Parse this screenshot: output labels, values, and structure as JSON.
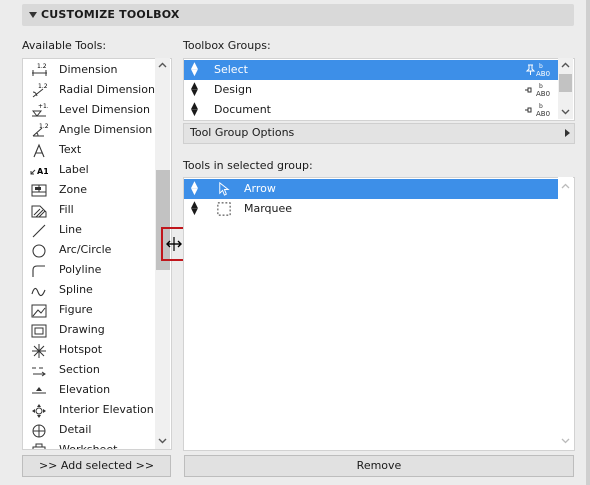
{
  "panel": {
    "title": "CUSTOMIZE TOOLBOX"
  },
  "available": {
    "label": "Available Tools:",
    "items": [
      {
        "label": "Dimension",
        "icon": "dimension-icon"
      },
      {
        "label": "Radial Dimension",
        "icon": "radial-dimension-icon"
      },
      {
        "label": "Level Dimension",
        "icon": "level-dimension-icon"
      },
      {
        "label": "Angle Dimension",
        "icon": "angle-dimension-icon"
      },
      {
        "label": "Text",
        "icon": "text-icon"
      },
      {
        "label": "Label",
        "icon": "label-icon"
      },
      {
        "label": "Zone",
        "icon": "zone-icon"
      },
      {
        "label": "Fill",
        "icon": "fill-icon"
      },
      {
        "label": "Line",
        "icon": "line-icon"
      },
      {
        "label": "Arc/Circle",
        "icon": "arc-circle-icon"
      },
      {
        "label": "Polyline",
        "icon": "polyline-icon"
      },
      {
        "label": "Spline",
        "icon": "spline-icon"
      },
      {
        "label": "Figure",
        "icon": "figure-icon"
      },
      {
        "label": "Drawing",
        "icon": "drawing-icon"
      },
      {
        "label": "Hotspot",
        "icon": "hotspot-icon"
      },
      {
        "label": "Section",
        "icon": "section-icon"
      },
      {
        "label": "Elevation",
        "icon": "elevation-icon"
      },
      {
        "label": "Interior Elevation",
        "icon": "interior-elevation-icon"
      },
      {
        "label": "Detail",
        "icon": "detail-icon"
      },
      {
        "label": "Worksheet",
        "icon": "worksheet-icon"
      }
    ],
    "add_button": ">> Add selected >>"
  },
  "groups": {
    "label": "Toolbox Groups:",
    "items": [
      {
        "label": "Select",
        "selected": true
      },
      {
        "label": "Design",
        "selected": false
      },
      {
        "label": "Document",
        "selected": false
      }
    ],
    "options_label": "Tool Group Options"
  },
  "tools": {
    "label": "Tools in selected group:",
    "items": [
      {
        "label": "Arrow",
        "icon": "arrow-cursor-icon",
        "selected": true
      },
      {
        "label": "Marquee",
        "icon": "marquee-icon",
        "selected": false
      }
    ],
    "remove_button": "Remove"
  },
  "colors": {
    "selection": "#3d8fe8",
    "highlight": "#c0161c"
  }
}
